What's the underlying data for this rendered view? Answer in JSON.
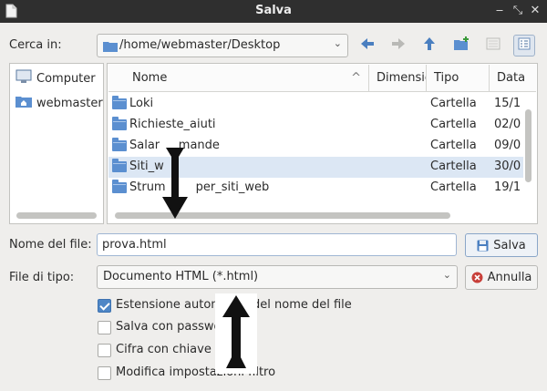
{
  "window": {
    "title": "Salva",
    "controls": {
      "minimize": "‒",
      "restore": "⤡",
      "close": "✕"
    }
  },
  "toolbar": {
    "look_in_label": "Cerca in:",
    "path": "/home/webmaster/Desktop",
    "buttons": [
      "back-icon",
      "forward-icon",
      "up-icon",
      "new-folder-icon",
      "list-view-icon",
      "detail-view-icon"
    ]
  },
  "places": [
    {
      "label": "Computer",
      "icon": "computer-icon"
    },
    {
      "label": "webmaster",
      "icon": "home-folder-icon"
    }
  ],
  "file_list": {
    "columns": [
      "Nome",
      "Dimensio",
      "Tipo",
      "Data"
    ],
    "rows": [
      {
        "name": "Loki",
        "type": "Cartella",
        "date": "15/1"
      },
      {
        "name": "Richieste_aiuti",
        "type": "Cartella",
        "date": "02/0"
      },
      {
        "name": "Salar     mande",
        "type": "Cartella",
        "date": "09/0"
      },
      {
        "name": "Siti_w",
        "type": "Cartella",
        "date": "30/0",
        "selected": true
      },
      {
        "name": "Strum        per_siti_web",
        "type": "Cartella",
        "date": "19/1"
      }
    ]
  },
  "filename": {
    "label": "Nome del file:",
    "value": "prova.html",
    "save_label": "Salva"
  },
  "filetype": {
    "label": "File di tipo:",
    "selected": "Documento HTML (*.html)",
    "cancel_label": "Annulla"
  },
  "options": [
    {
      "label": "Estensione autom        del nome del file",
      "checked": true
    },
    {
      "label": "Salva con passwo",
      "checked": false
    },
    {
      "label": "Cifra con chiave G",
      "checked": false
    },
    {
      "label": "Modifica impostazioni filtro",
      "checked": false
    }
  ],
  "colors": {
    "accent": "#4e86c6",
    "selection": "#dce7f4",
    "titlebar": "#2f2f2f"
  }
}
